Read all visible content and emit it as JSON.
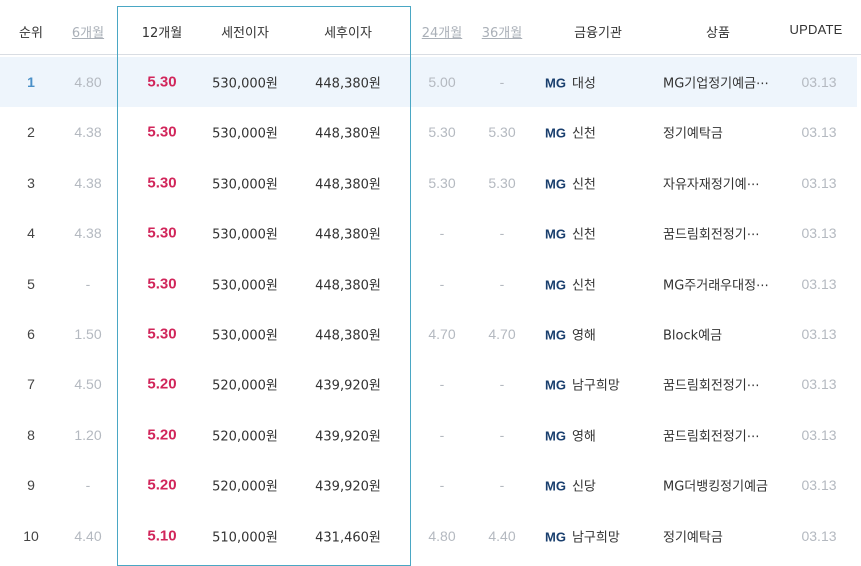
{
  "header": {
    "rank": "순위",
    "m6": "6개월",
    "m12": "12개월",
    "pretax": "세전이자",
    "posttax": "세후이자",
    "m24": "24개월",
    "m36": "36개월",
    "institution": "금융기관",
    "product": "상품",
    "update": "UPDATE"
  },
  "rows": [
    {
      "rank": "1",
      "m6": "4.80",
      "m12": "5.30",
      "pretax": "530,000원",
      "posttax": "448,380원",
      "m24": "5.00",
      "m36": "-",
      "logo": "MG",
      "inst": "대성",
      "product": "MG기업정기예금⋯",
      "update": "03.13"
    },
    {
      "rank": "2",
      "m6": "4.38",
      "m12": "5.30",
      "pretax": "530,000원",
      "posttax": "448,380원",
      "m24": "5.30",
      "m36": "5.30",
      "logo": "MG",
      "inst": "신천",
      "product": "정기예탁금",
      "update": "03.13"
    },
    {
      "rank": "3",
      "m6": "4.38",
      "m12": "5.30",
      "pretax": "530,000원",
      "posttax": "448,380원",
      "m24": "5.30",
      "m36": "5.30",
      "logo": "MG",
      "inst": "신천",
      "product": "자유자재정기예⋯",
      "update": "03.13"
    },
    {
      "rank": "4",
      "m6": "4.38",
      "m12": "5.30",
      "pretax": "530,000원",
      "posttax": "448,380원",
      "m24": "-",
      "m36": "-",
      "logo": "MG",
      "inst": "신천",
      "product": "꿈드림회전정기⋯",
      "update": "03.13"
    },
    {
      "rank": "5",
      "m6": "-",
      "m12": "5.30",
      "pretax": "530,000원",
      "posttax": "448,380원",
      "m24": "-",
      "m36": "-",
      "logo": "MG",
      "inst": "신천",
      "product": "MG주거래우대정⋯",
      "update": "03.13"
    },
    {
      "rank": "6",
      "m6": "1.50",
      "m12": "5.30",
      "pretax": "530,000원",
      "posttax": "448,380원",
      "m24": "4.70",
      "m36": "4.70",
      "logo": "MG",
      "inst": "영해",
      "product": "Block예금",
      "update": "03.13"
    },
    {
      "rank": "7",
      "m6": "4.50",
      "m12": "5.20",
      "pretax": "520,000원",
      "posttax": "439,920원",
      "m24": "-",
      "m36": "-",
      "logo": "MG",
      "inst": "남구희망",
      "product": "꿈드림회전정기⋯",
      "update": "03.13"
    },
    {
      "rank": "8",
      "m6": "1.20",
      "m12": "5.20",
      "pretax": "520,000원",
      "posttax": "439,920원",
      "m24": "-",
      "m36": "-",
      "logo": "MG",
      "inst": "영해",
      "product": "꿈드림회전정기⋯",
      "update": "03.13"
    },
    {
      "rank": "9",
      "m6": "-",
      "m12": "5.20",
      "pretax": "520,000원",
      "posttax": "439,920원",
      "m24": "-",
      "m36": "-",
      "logo": "MG",
      "inst": "신당",
      "product": "MG더뱅킹정기예금",
      "update": "03.13"
    },
    {
      "rank": "10",
      "m6": "4.40",
      "m12": "5.10",
      "pretax": "510,000원",
      "posttax": "431,460원",
      "m24": "4.80",
      "m36": "4.40",
      "logo": "MG",
      "inst": "남구희망",
      "product": "정기예탁금",
      "update": "03.13"
    }
  ],
  "colors": {
    "rate_highlight": "#d1255a",
    "dim_text": "#b4b9c0",
    "logo": "#1a3f6e",
    "box_border": "#4aa7c4",
    "first_row_bg": "#eef5fc"
  }
}
